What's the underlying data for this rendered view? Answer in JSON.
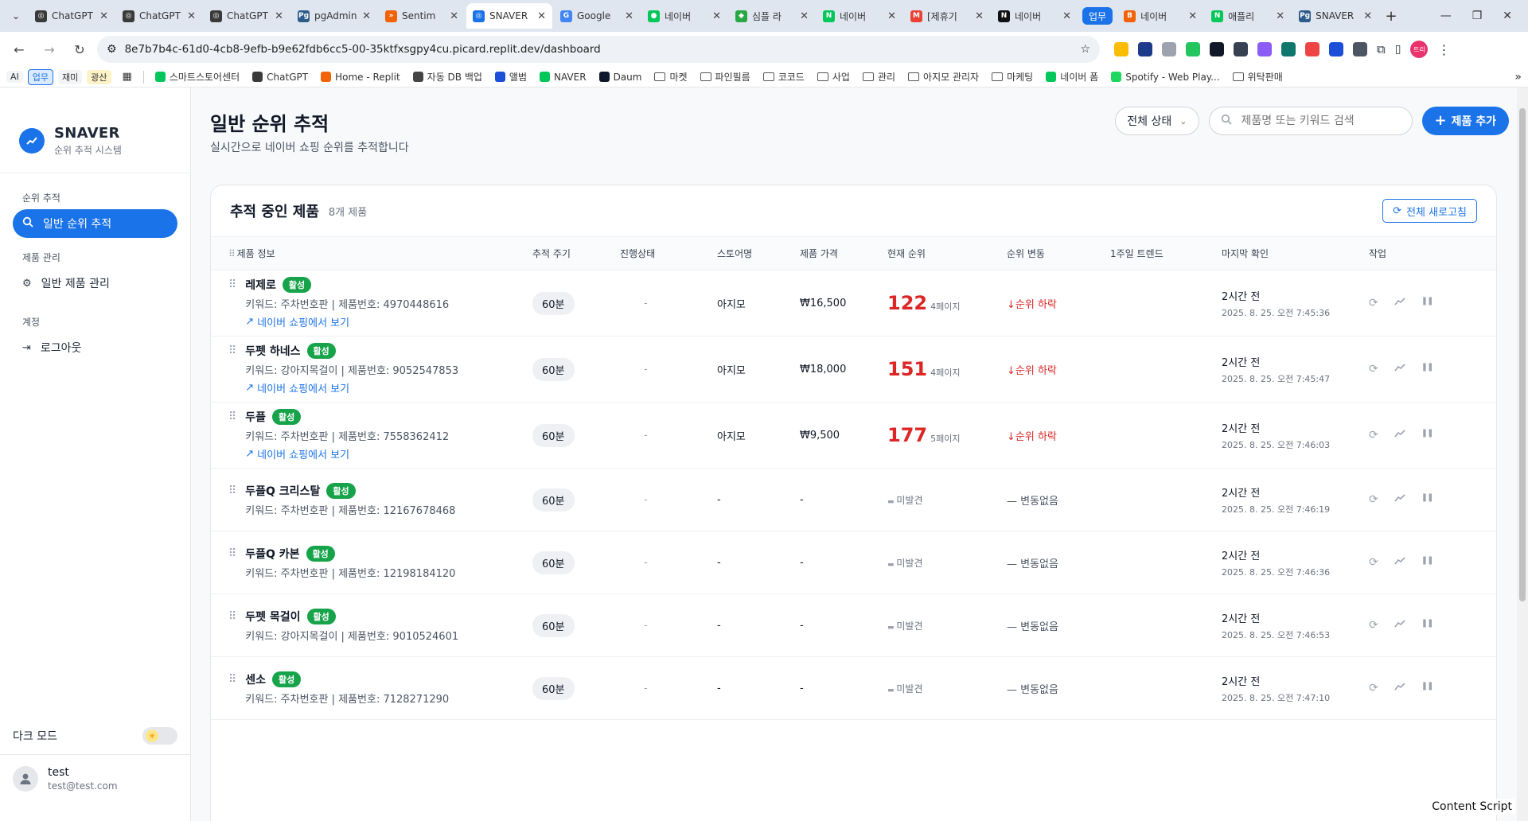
{
  "browser": {
    "tabs": [
      {
        "title": "ChatGPT",
        "color": "#3a3a3a",
        "glyph": "◎"
      },
      {
        "title": "ChatGPT",
        "color": "#3a3a3a",
        "glyph": "◎"
      },
      {
        "title": "ChatGPT",
        "color": "#3a3a3a",
        "glyph": "◎"
      },
      {
        "title": "pgAdmin",
        "color": "#2f5b8a",
        "glyph": "Pg"
      },
      {
        "title": "Sentim",
        "color": "#f26207",
        "glyph": "»"
      },
      {
        "title": "SNAVER",
        "color": "#1a73e8",
        "glyph": "◎",
        "active": true
      },
      {
        "title": "Google",
        "color": "#4285f4",
        "glyph": "G"
      },
      {
        "title": "네이버",
        "color": "#03c75a",
        "glyph": "●"
      },
      {
        "title": "심플 라",
        "color": "#28a745",
        "glyph": "◆"
      },
      {
        "title": "네이버",
        "color": "#03c75a",
        "glyph": "N"
      },
      {
        "title": "[제휴기",
        "color": "#ea4335",
        "glyph": "M"
      },
      {
        "title": "네이버",
        "color": "#111111",
        "glyph": "N"
      },
      {
        "title": "네이버",
        "color": "#f26207",
        "glyph": "B"
      },
      {
        "title": "애플리",
        "color": "#03c75a",
        "glyph": "N"
      },
      {
        "title": "SNAVER",
        "color": "#2f5b8a",
        "glyph": "Pg"
      }
    ],
    "tab_group_label": "업무",
    "url": "8e7b7b4c-61d0-4cb8-9efb-b9e62fdb6cc5-00-35ktfxsgpy4cu.picard.replit.dev/dashboard",
    "profile_label": "트리",
    "bookmarks": {
      "chips": [
        "AI",
        "업무",
        "재미",
        "광산"
      ],
      "items": [
        "스마트스토어센터",
        "ChatGPT",
        "Home - Replit",
        "자동 DB 백업",
        "앨범",
        "NAVER",
        "Daum",
        "마켓",
        "파인필름",
        "코코드",
        "사업",
        "관리",
        "아지모 관리자",
        "마케팅",
        "네이버 폼",
        "Spotify - Web Play...",
        "위탁판매"
      ]
    }
  },
  "sidebar": {
    "brand": "SNAVER",
    "brand_sub": "순위 추적 시스템",
    "section_rank": "순위 추적",
    "item_general_rank": "일반 순위 추적",
    "section_product": "제품 관리",
    "item_product_manage": "일반 제품 관리",
    "section_account": "계정",
    "item_logout": "로그아웃",
    "dark_mode_label": "다크 모드",
    "user_name": "test",
    "user_email": "test@test.com"
  },
  "header": {
    "title": "일반 순위 추적",
    "subtitle": "실시간으로 네이버 쇼핑 순위를 추적합니다",
    "status_filter": "전체 상태",
    "search_placeholder": "제품명 또는 키워드 검색",
    "add_button": "제품 추가"
  },
  "card": {
    "title": "추적 중인 제품",
    "count": "8개 제품",
    "refresh_all": "전체 새로고침",
    "columns": [
      "제품 정보",
      "추적 주기",
      "진행상태",
      "스토어명",
      "제품 가격",
      "현재 순위",
      "순위 변동",
      "1주일 트렌드",
      "마지막 확인",
      "작업"
    ]
  },
  "products": [
    {
      "name": "레제로",
      "status": "활성",
      "meta": "키워드: 주차번호판 | 제품번호: 4970448616",
      "link": "네이버 쇼핑에서 보기",
      "interval": "60분",
      "progress": "-",
      "store": "아지모",
      "price": "₩16,500",
      "rank": "122",
      "rank_page": "4페이지",
      "change": "순위 하락",
      "last_rel": "2시간 전",
      "last_abs": "2025. 8. 25. 오전 7:45:36"
    },
    {
      "name": "두펫 하네스",
      "status": "활성",
      "meta": "키워드: 강아지목걸이 | 제품번호: 9052547853",
      "link": "네이버 쇼핑에서 보기",
      "interval": "60분",
      "progress": "-",
      "store": "아지모",
      "price": "₩18,000",
      "rank": "151",
      "rank_page": "4페이지",
      "change": "순위 하락",
      "last_rel": "2시간 전",
      "last_abs": "2025. 8. 25. 오전 7:45:47"
    },
    {
      "name": "두플",
      "status": "활성",
      "meta": "키워드: 주차번호판 | 제품번호: 7558362412",
      "link": "네이버 쇼핑에서 보기",
      "interval": "60분",
      "progress": "-",
      "store": "아지모",
      "price": "₩9,500",
      "rank": "177",
      "rank_page": "5페이지",
      "change": "순위 하락",
      "last_rel": "2시간 전",
      "last_abs": "2025. 8. 25. 오전 7:46:03"
    },
    {
      "name": "두플Q 크리스탈",
      "status": "활성",
      "meta": "키워드: 주차번호판 | 제품번호: 12167678468",
      "interval": "60분",
      "progress": "-",
      "store": "-",
      "price": "-",
      "rank_none": "미발견",
      "change_none": "변동없음",
      "last_rel": "2시간 전",
      "last_abs": "2025. 8. 25. 오전 7:46:19"
    },
    {
      "name": "두플Q 카본",
      "status": "활성",
      "meta": "키워드: 주차번호판 | 제품번호: 12198184120",
      "interval": "60분",
      "progress": "-",
      "store": "-",
      "price": "-",
      "rank_none": "미발견",
      "change_none": "변동없음",
      "last_rel": "2시간 전",
      "last_abs": "2025. 8. 25. 오전 7:46:36"
    },
    {
      "name": "두펫 목걸이",
      "status": "활성",
      "meta": "키워드: 강아지목걸이 | 제품번호: 9010524601",
      "interval": "60분",
      "progress": "-",
      "store": "-",
      "price": "-",
      "rank_none": "미발견",
      "change_none": "변동없음",
      "last_rel": "2시간 전",
      "last_abs": "2025. 8. 25. 오전 7:46:53"
    },
    {
      "name": "센소",
      "status": "활성",
      "meta": "키워드: 주차번호판 | 제품번호: 7128271290",
      "interval": "60분",
      "progress": "-",
      "store": "-",
      "price": "-",
      "rank_none": "미발견",
      "change_none": "변동없음",
      "last_rel": "2시간 전",
      "last_abs": "2025. 8. 25. 오전 7:47:10"
    }
  ],
  "overlay": {
    "content_script": "Content Script"
  },
  "colors": {
    "accent": "#1a73e8",
    "active_badge": "#16a34a",
    "rank_red": "#dc2626"
  }
}
